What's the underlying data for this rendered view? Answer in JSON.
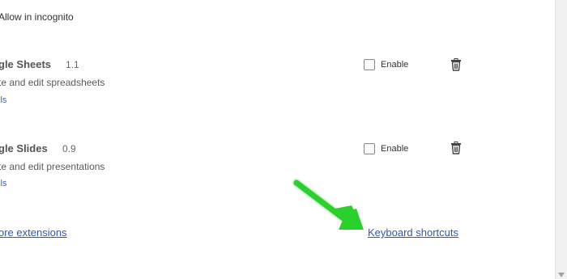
{
  "top": {
    "incognito_label": "Allow in incognito"
  },
  "extensions": [
    {
      "name": "gle Sheets",
      "version": "1.1",
      "description": "te and edit spreadsheets",
      "details_link": "ils",
      "enable_label": "Enable",
      "enabled": false
    },
    {
      "name": "gle Slides",
      "version": "0.9",
      "description": "te and edit presentations",
      "details_link": "ils",
      "enable_label": "Enable",
      "enabled": false
    }
  ],
  "footer": {
    "more_extensions_link": "ore extensions",
    "keyboard_shortcuts_link": "Keyboard shortcuts"
  },
  "colors": {
    "link": "#2e59b3",
    "annotation_arrow": "#2bd12b"
  },
  "icons": {
    "delete": "trash-icon",
    "annotation": "green-arrow-icon"
  }
}
